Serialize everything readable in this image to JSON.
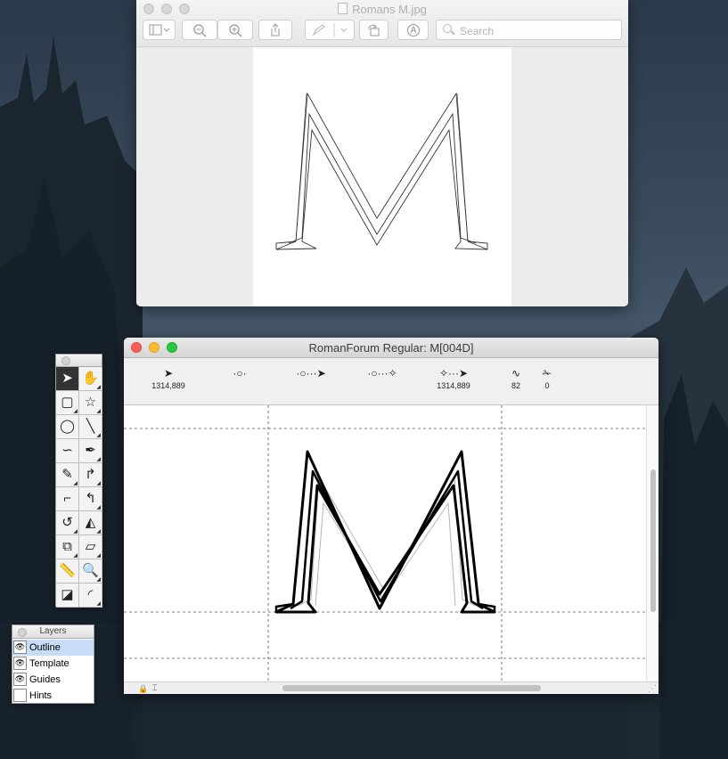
{
  "preview": {
    "title": "Romans M.jpg",
    "search_placeholder": "Search",
    "toolbar": {
      "sidebar_icon": "sidebar-icon",
      "zoom_out_icon": "zoom-out-icon",
      "zoom_in_icon": "zoom-in-icon",
      "share_icon": "share-icon",
      "markup_icon": "pen-icon",
      "rotate_icon": "rotate-icon",
      "annotate_icon": "markup-icon"
    }
  },
  "editor": {
    "title": "RomanForum Regular: M[004D]",
    "info": [
      {
        "icon": "pointer-icon",
        "glyph": "➤",
        "value": "1314,889"
      },
      {
        "icon": "point-icon",
        "glyph": "·○·",
        "value": ""
      },
      {
        "icon": "delta-icon",
        "glyph": "·○···➤",
        "value": ""
      },
      {
        "icon": "angle-icon",
        "glyph": "·○···✧",
        "value": ""
      },
      {
        "icon": "pointer-offset-icon",
        "glyph": "✧···➤",
        "value": "1314,889"
      },
      {
        "icon": "curve-icon",
        "glyph": "∿",
        "value": "82"
      },
      {
        "icon": "tangent-icon",
        "glyph": "✁",
        "value": "0"
      }
    ],
    "lock_icon": "🔒",
    "mode_icon": "⌶",
    "grip_icon": "⋰"
  },
  "tools": [
    {
      "name": "pointer-tool-icon",
      "glyph": "➤",
      "active": true
    },
    {
      "name": "hand-tool-icon",
      "glyph": "✋",
      "active": false
    },
    {
      "name": "rectangle-tool-icon",
      "glyph": "▢",
      "active": false
    },
    {
      "name": "star-tool-icon",
      "glyph": "☆",
      "active": false
    },
    {
      "name": "ellipse-tool-icon",
      "glyph": "◯",
      "active": false
    },
    {
      "name": "line-tool-icon",
      "glyph": "╲",
      "active": false
    },
    {
      "name": "freehand-tool-icon",
      "glyph": "∽",
      "active": false
    },
    {
      "name": "pen-tool-icon",
      "glyph": "✒",
      "active": false
    },
    {
      "name": "knife-tool-icon",
      "glyph": "✎",
      "active": false
    },
    {
      "name": "curve-point-tool-icon",
      "glyph": "↱",
      "active": false
    },
    {
      "name": "corner-point-tool-icon",
      "glyph": "⌐",
      "active": false
    },
    {
      "name": "tangent-point-tool-icon",
      "glyph": "↰",
      "active": false
    },
    {
      "name": "rotate-tool-icon",
      "glyph": "↺",
      "active": false
    },
    {
      "name": "flip-tool-icon",
      "glyph": "◭",
      "active": false
    },
    {
      "name": "scale-tool-icon",
      "glyph": "⧉",
      "active": false
    },
    {
      "name": "skew-tool-icon",
      "glyph": "▱",
      "active": false
    },
    {
      "name": "ruler-tool-icon",
      "glyph": "📏",
      "active": false
    },
    {
      "name": "magnify-tool-icon",
      "glyph": "🔍",
      "active": false
    },
    {
      "name": "perspective-tool-icon",
      "glyph": "◪",
      "active": false
    },
    {
      "name": "shape-tool-icon",
      "glyph": "◜",
      "active": false
    }
  ],
  "layers": {
    "title": "Layers",
    "items": [
      {
        "name": "Outline",
        "visible": true,
        "selected": true
      },
      {
        "name": "Template",
        "visible": true,
        "selected": false
      },
      {
        "name": "Guides",
        "visible": true,
        "selected": false
      },
      {
        "name": "Hints",
        "visible": false,
        "selected": false
      }
    ]
  }
}
